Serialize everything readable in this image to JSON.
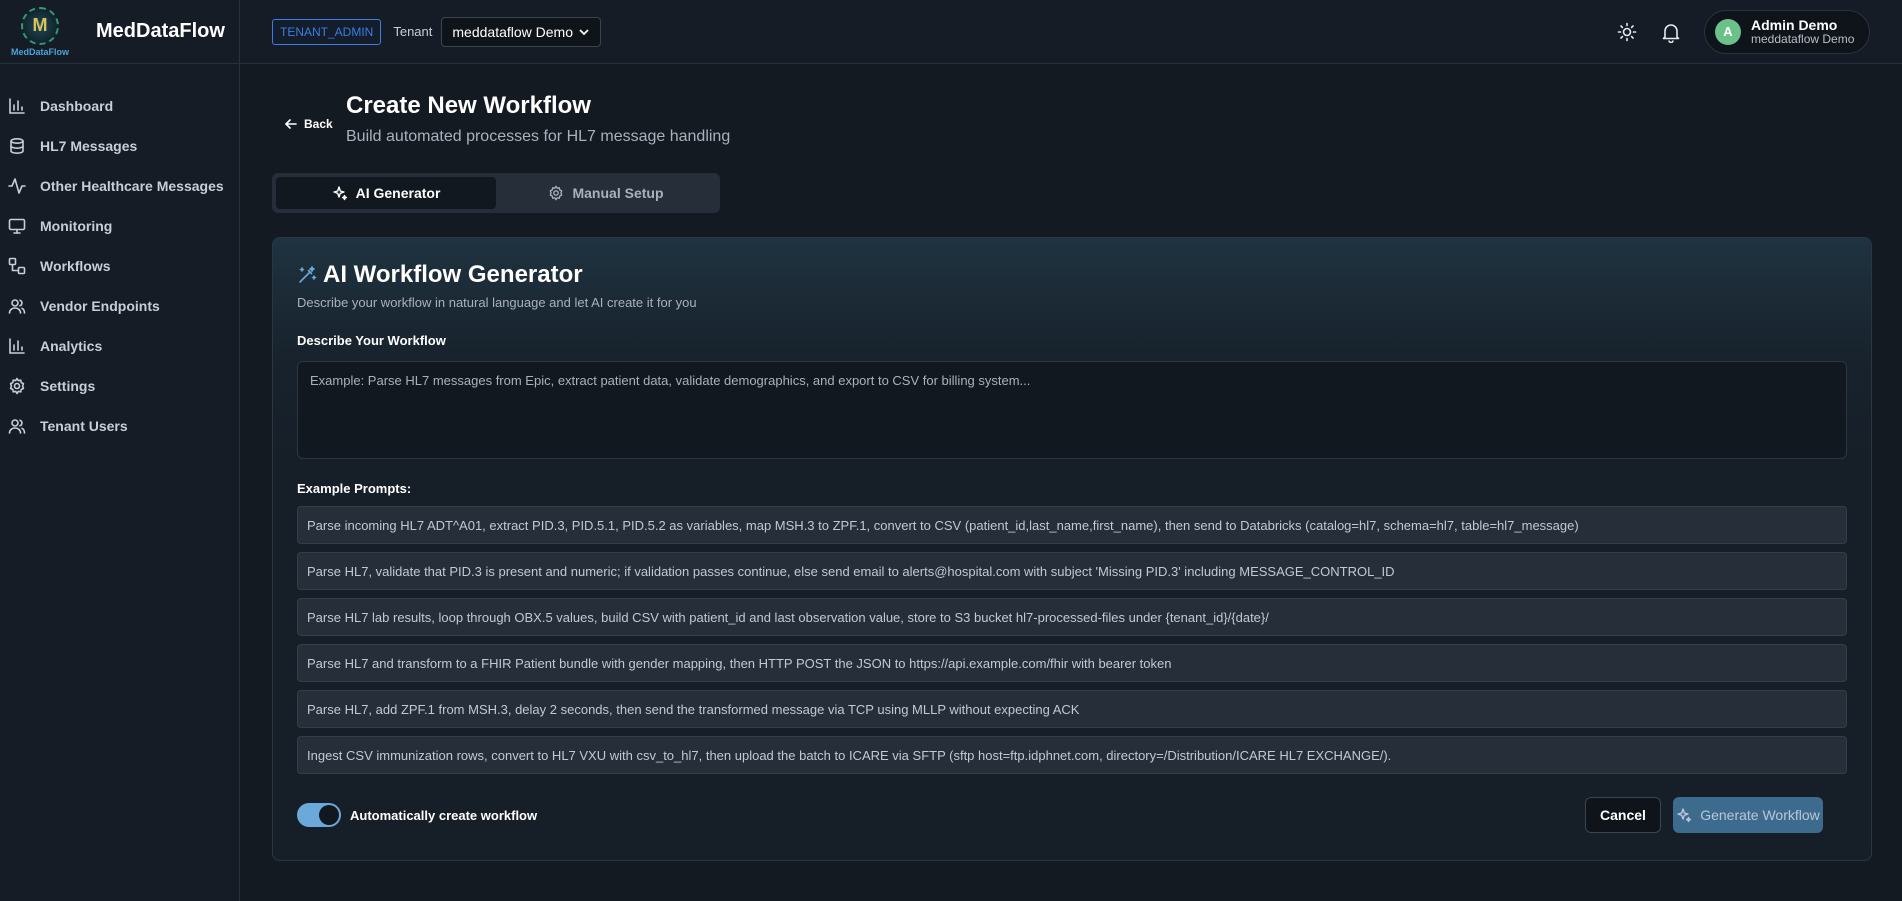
{
  "brand": {
    "logo_letter": "M",
    "logo_caption": "MedDataFlow",
    "name": "MedDataFlow"
  },
  "header": {
    "role_badge": "TENANT_ADMIN",
    "tenant_label": "Tenant",
    "tenant_selected": "meddataflow Demo",
    "theme_icon": "sun-icon",
    "notification_icon": "bell-icon",
    "user": {
      "avatar_initial": "A",
      "name": "Admin Demo",
      "org": "meddataflow Demo",
      "avatar_color": "#6ac28a"
    }
  },
  "sidebar": {
    "items": [
      {
        "label": "Dashboard",
        "icon": "bar-chart-icon"
      },
      {
        "label": "HL7 Messages",
        "icon": "database-icon"
      },
      {
        "label": "Other Healthcare Messages",
        "icon": "activity-icon"
      },
      {
        "label": "Monitoring",
        "icon": "monitor-icon"
      },
      {
        "label": "Workflows",
        "icon": "workflow-icon"
      },
      {
        "label": "Vendor Endpoints",
        "icon": "users-icon"
      },
      {
        "label": "Analytics",
        "icon": "bar-chart-icon"
      },
      {
        "label": "Settings",
        "icon": "gear-icon"
      },
      {
        "label": "Tenant Users",
        "icon": "users-icon"
      }
    ]
  },
  "page": {
    "back_label": "Back",
    "title": "Create New Workflow",
    "subtitle": "Build automated processes for HL7 message handling"
  },
  "tabs": [
    {
      "label": "AI Generator",
      "active": true,
      "icon": "sparkles-icon"
    },
    {
      "label": "Manual Setup",
      "active": false,
      "icon": "gear-icon"
    }
  ],
  "generator": {
    "title": "AI Workflow Generator",
    "description": "Describe your workflow in natural language and let AI create it for you",
    "field_label": "Describe Your Workflow",
    "placeholder": "Example: Parse HL7 messages from Epic, extract patient data, validate demographics, and export to CSV for billing system...",
    "examples_label": "Example Prompts:",
    "examples": [
      "Parse incoming HL7 ADT^A01, extract PID.3, PID.5.1, PID.5.2 as variables, map MSH.3 to ZPF.1, convert to CSV (patient_id,last_name,first_name), then send to Databricks (catalog=hl7, schema=hl7, table=hl7_message)",
      "Parse HL7, validate that PID.3 is present and numeric; if validation passes continue, else send email to alerts@hospital.com with subject 'Missing PID.3' including MESSAGE_CONTROL_ID",
      "Parse HL7 lab results, loop through OBX.5 values, build CSV with patient_id and last observation value, store to S3 bucket hl7-processed-files under {tenant_id}/{date}/",
      "Parse HL7 and transform to a FHIR Patient bundle with gender mapping, then HTTP POST the JSON to https://api.example.com/fhir with bearer token",
      "Parse HL7, add ZPF.1 from MSH.3, delay 2 seconds, then send the transformed message via TCP using MLLP without expecting ACK",
      "Ingest CSV immunization rows, convert to HL7 VXU with csv_to_hl7, then upload the batch to ICARE via SFTP (sftp host=ftp.idphnet.com, directory=/Distribution/ICARE HL7 EXCHANGE/)."
    ],
    "auto_create_label": "Automatically create workflow",
    "auto_create_enabled": true,
    "cancel_label": "Cancel",
    "generate_label": "Generate Workflow"
  },
  "colors": {
    "background": "#141a22",
    "accent": "#6aa9d9",
    "role_badge": "#3b7de0",
    "generate_button": "#3d6b8e"
  }
}
